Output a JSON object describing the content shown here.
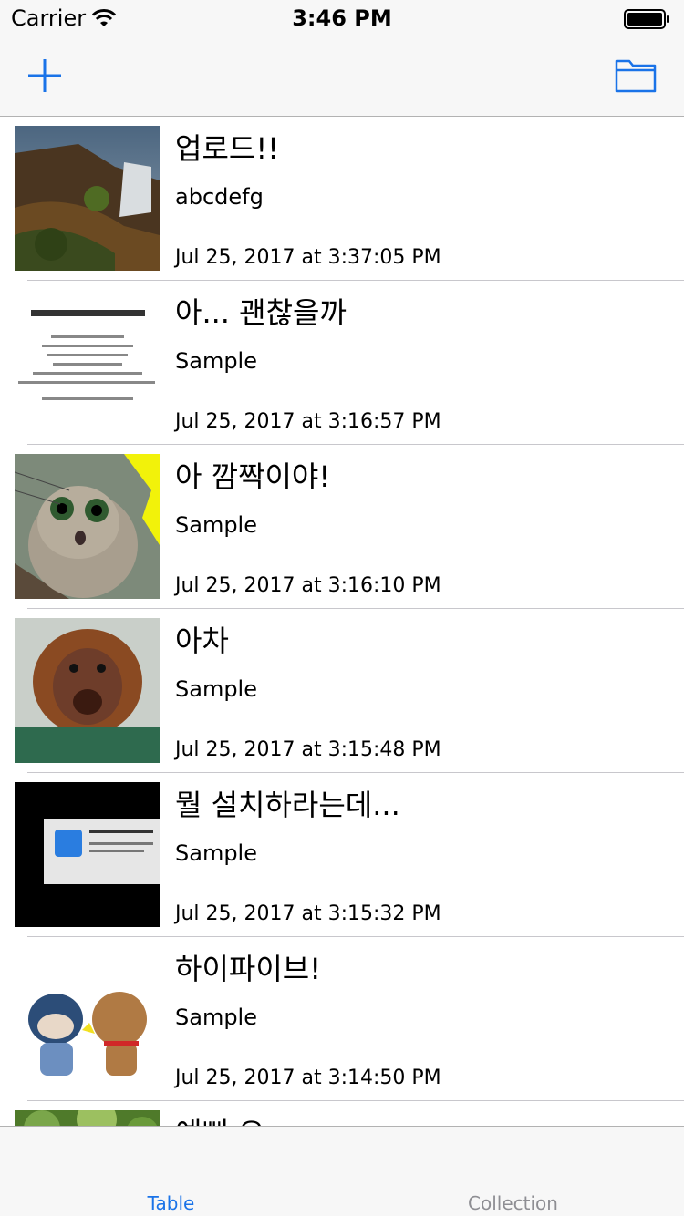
{
  "status_bar": {
    "carrier": "Carrier",
    "time": "3:46 PM",
    "icons": [
      "wifi-icon",
      "battery-icon"
    ]
  },
  "nav_bar": {
    "left_icon": "plus-icon",
    "right_icon": "folder-icon",
    "accent_color": "#1a73e8"
  },
  "list": {
    "rows": [
      {
        "title": "업로드!!",
        "subtitle": "abcdefg",
        "date": "Jul 25, 2017 at 3:37:05 PM",
        "thumbnail": "waterfall-landscape-photo"
      },
      {
        "title": "아... 괜찮을까",
        "subtitle": "Sample",
        "date": "Jul 25, 2017 at 3:16:57 PM",
        "thumbnail": "korean-text-quote-image"
      },
      {
        "title": "아 깜짝이야!",
        "subtitle": "Sample",
        "date": "Jul 25, 2017 at 3:16:10 PM",
        "thumbnail": "surprised-cat-photo"
      },
      {
        "title": "아차",
        "subtitle": "Sample",
        "date": "Jul 25, 2017 at 3:15:48 PM",
        "thumbnail": "baby-orangutan-photo"
      },
      {
        "title": "뭘 설치하라는데...",
        "subtitle": "Sample",
        "date": "Jul 25, 2017 at 3:15:32 PM",
        "thumbnail": "xcode-install-dialog-screenshot"
      },
      {
        "title": "하이파이브!",
        "subtitle": "Sample",
        "date": "Jul 25, 2017 at 3:14:50 PM",
        "thumbnail": "cartoon-high-five-image"
      },
      {
        "title": "예뻐 요",
        "subtitle": "",
        "date": "",
        "thumbnail": "green-foliage-photo"
      }
    ]
  },
  "tab_bar": {
    "tabs": [
      {
        "label": "Table",
        "selected": true
      },
      {
        "label": "Collection",
        "selected": false
      }
    ],
    "selected_color": "#1a73e8",
    "unselected_color": "#8e8e93"
  }
}
